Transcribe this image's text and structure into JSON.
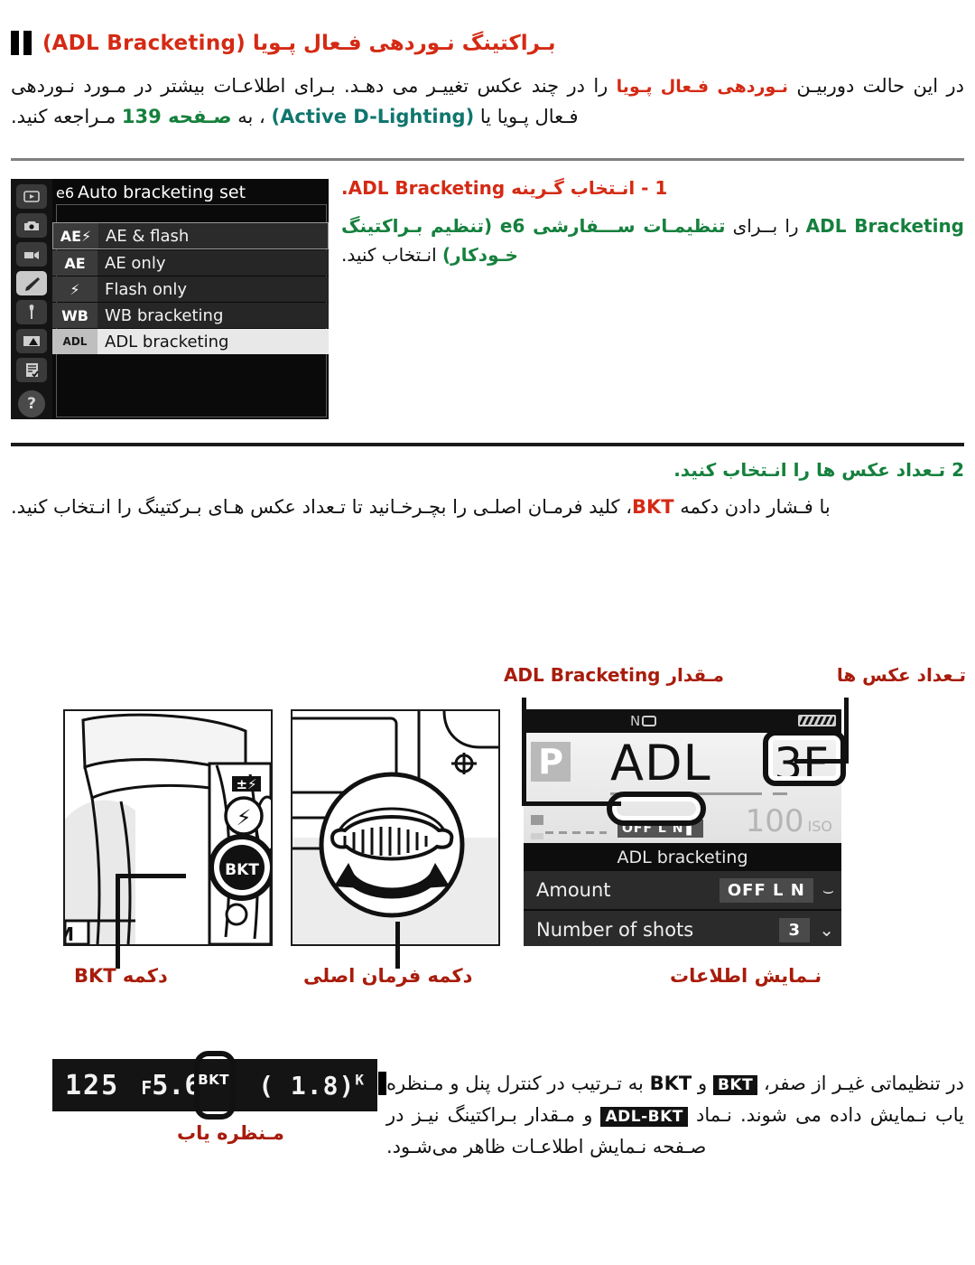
{
  "section": {
    "bullet": "double-bar-bullet",
    "title": "بـراکتینگ نـوردهی فـعال پـویا (ADL Bracketing)",
    "intro_p1_a": "در این حالت دوربیـن ",
    "intro_p1_red": "نـوردهی فـعال پـویا",
    "intro_p1_b": " را در چند عکس تغییـر می دهـد. بـرای اطلاعـات بیشتر در مـورد نـوردهی فـعال پـویا یا ",
    "intro_teal": "(Active D-Lighting)",
    "intro_p1_c": " ، به ",
    "intro_green": "صـفحه 139",
    "intro_p1_d": " مـراجعه کنید."
  },
  "step1": {
    "title": "1 - انـتخاب گـرینه ADL Bracketing.",
    "body_a": "ADL Bracketing",
    "body_b": " را بــرای ",
    "body_green": "تنظیمـات ســـفارشی e6 (تنظیم بـراکتینگ خـودکار)",
    "body_c": " انـتخاب کنید."
  },
  "menu_shot": {
    "header_code": "e6",
    "header_title": "Auto bracketing set",
    "sidebar_icons": [
      "playback-icon",
      "shooting-menu-icon",
      "movie-menu-icon",
      "custom-settings-pencil-icon",
      "setup-wrench-icon",
      "retouch-icon",
      "recent-settings-icon",
      "help-question-icon"
    ],
    "rows": [
      {
        "icon": "AE⚡",
        "label": "AE & flash",
        "state": "framed"
      },
      {
        "icon": "AE",
        "label": "AE only",
        "state": "normal"
      },
      {
        "icon": "⚡",
        "label": "Flash only",
        "state": "normal"
      },
      {
        "icon": "WB",
        "label": "WB bracketing",
        "state": "normal"
      },
      {
        "icon": "ADL",
        "label": "ADL bracketing",
        "state": "selected"
      }
    ]
  },
  "step2": {
    "title": "2 تـعداد عکس ها را انـتخاب کنید.",
    "body_a": "با فـشار دادن دکمه ",
    "body_red": "BKT",
    "body_b": "، کلید فرمـان اصلـی را بچـرخـانید تا تـعداد عکس هـای بـرکتینگ را انـتخاب کنید."
  },
  "figure": {
    "label_amount": "مـقدار ADL Bracketing",
    "label_shots": "تـعداد عکس ها",
    "caption_bkt_button": "دکمه BKT",
    "caption_main_dial": "دکمه فرمان اصلی",
    "caption_info_display": "نـمایش اطلاعات",
    "caption_viewfinder": "مـنظره یاب",
    "bkt_button_label": "BKT",
    "flash_button_label": "flash-icon",
    "flash_comp_label": "flash-compensation-icon",
    "dial_label": "main-command-dial"
  },
  "info_display": {
    "top_badge": "N",
    "battery": "battery-icon",
    "mode": "P",
    "adl_text": "ADL",
    "frames": "3F",
    "iso_label": "ISO",
    "iso_value": "100",
    "amount_badge": "OFF L N",
    "caption": "ADL bracketing",
    "rows": [
      {
        "label": "Amount",
        "value": "OFF L N",
        "glyph": "bracket-amount-icon"
      },
      {
        "label": "Number of shots",
        "value": "3",
        "glyph": "bracket-shots-icon"
      }
    ]
  },
  "viewfinder": {
    "shutter_speed": "125",
    "aperture_prefix": "F",
    "aperture": "5.6",
    "bkt_indicator": "BKT",
    "frames_open": "(",
    "frames_count": "1.8",
    "frames_close": ")",
    "frames_unit": "K"
  },
  "note": {
    "a": "در تنظیماتی غیـر از صفر، ",
    "chip1": "BKT",
    "b": " و ",
    "bold1": "BKT",
    "c": " به تـرتیب در کنترل پنل و مـنظره یاب نـمایش داده می شوند. نـماد ",
    "chip2": "ADL-BKT",
    "d": " و مـقدار بـراکتینگ نیـز در صـفحه نـمایش اطلاعـات ظاهر می‌شـود."
  },
  "colors": {
    "heading_red": "#d42a14",
    "caption_red": "#a81c0b",
    "green": "#15803d",
    "teal": "#0f766e",
    "black": "#111111"
  }
}
